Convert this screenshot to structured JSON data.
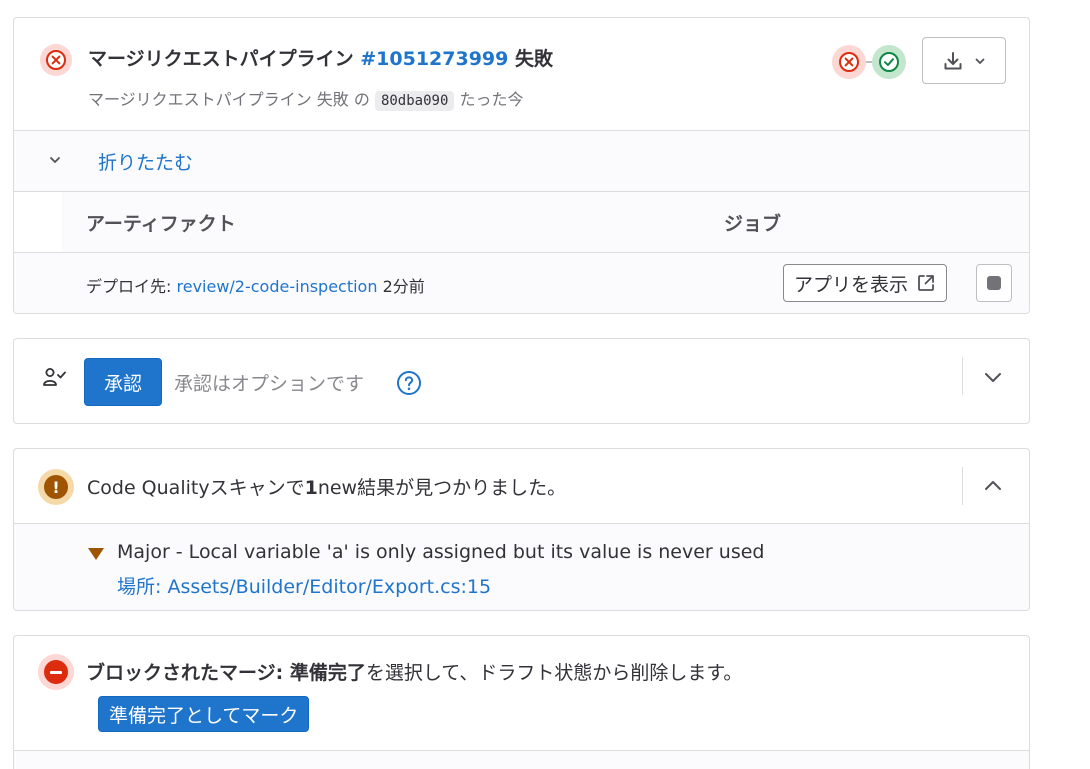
{
  "pipeline": {
    "title_prefix": "マージリクエストパイプライン",
    "pipeline_id": "#1051273999",
    "status_label": "失敗",
    "subtitle_prefix": "マージリクエストパイプライン 失敗 の",
    "commit_sha": "80dba090",
    "time_ago": "たった今",
    "status_icon": "failed-status-icon",
    "stages": [
      {
        "status": "failed",
        "icon": "close-circle-icon"
      },
      {
        "status": "success",
        "icon": "check-circle-icon"
      }
    ]
  },
  "collapse": {
    "label": "折りたたむ"
  },
  "table": {
    "col_artifacts": "アーティファクト",
    "col_jobs": "ジョブ"
  },
  "deploy": {
    "prefix": "デプロイ先:",
    "environment": "review/2-code-inspection",
    "time_ago": "2分前",
    "view_app_label": "アプリを表示"
  },
  "approval": {
    "button_label": "承認",
    "optional_text": "承認はオプションです"
  },
  "code_quality": {
    "title_prefix": "Code Qualityスキャンで",
    "count": "1",
    "title_suffix": "new結果が見つかりました。",
    "finding": "Major - Local variable 'a' is only assigned but its value is never used",
    "location": "場所: Assets/Builder/Editor/Export.cs:15"
  },
  "blocked": {
    "label_bold": "ブロックされたマージ: 準備完了",
    "label_rest": "を選択して、ドラフト状態から削除します。",
    "button_label": "準備完了としてマーク"
  },
  "colors": {
    "link": "#1f75cb",
    "danger": "#dd2b0e",
    "success": "#108548",
    "warning": "#9e5400"
  }
}
